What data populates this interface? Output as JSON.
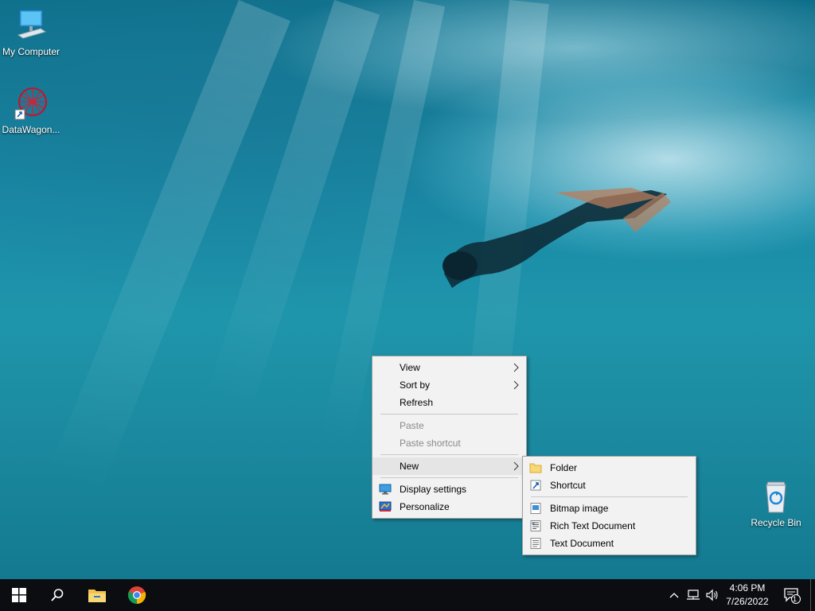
{
  "desktop": {
    "icons": [
      {
        "label": "My Computer",
        "icon": "computer-icon"
      },
      {
        "label": "DataWagon...",
        "icon": "datawagon-app-icon"
      },
      {
        "label": "Recycle Bin",
        "icon": "recycle-bin-icon"
      }
    ]
  },
  "context_menu": {
    "items": [
      {
        "label": "View",
        "submenu": true
      },
      {
        "label": "Sort by",
        "submenu": true
      },
      {
        "label": "Refresh"
      },
      {
        "label": "Paste",
        "disabled": true
      },
      {
        "label": "Paste shortcut",
        "disabled": true
      },
      {
        "label": "New",
        "submenu": true,
        "highlighted": true
      },
      {
        "label": "Display settings",
        "icon": "display-settings-icon"
      },
      {
        "label": "Personalize",
        "icon": "personalize-icon"
      }
    ]
  },
  "new_submenu": {
    "items": [
      {
        "label": "Folder",
        "icon": "folder-icon"
      },
      {
        "label": "Shortcut",
        "icon": "shortcut-icon"
      },
      {
        "label": "Bitmap image",
        "icon": "bitmap-image-icon"
      },
      {
        "label": "Rich Text Document",
        "icon": "rich-text-document-icon"
      },
      {
        "label": "Text Document",
        "icon": "text-document-icon"
      }
    ]
  },
  "taskbar": {
    "apps": [
      "start-icon",
      "search-icon",
      "file-explorer-icon",
      "chrome-icon"
    ],
    "tray": [
      "chevron-up-icon",
      "network-icon",
      "volume-icon"
    ],
    "time": "4:06 PM",
    "date": "7/26/2022",
    "notification_count": "1"
  },
  "colors": {
    "menu_bg": "#f2f2f2",
    "menu_highlight": "#e5e5e5",
    "taskbar_bg": "#0b0d11"
  }
}
